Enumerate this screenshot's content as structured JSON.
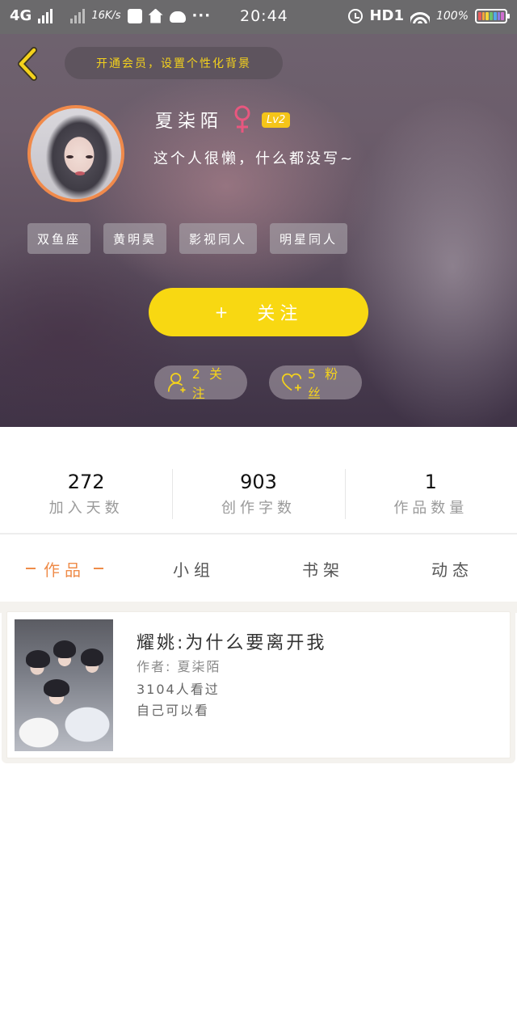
{
  "status_bar": {
    "network": "4G",
    "speed": "16K/s",
    "time": "20:44",
    "hd": "HD1",
    "battery_percent": "100%",
    "icons": [
      "signal-icon",
      "alipay-icon",
      "home-icon",
      "cloud-icon",
      "more-icon",
      "alarm-icon",
      "wifi-icon",
      "battery-icon"
    ]
  },
  "header": {
    "back_icon": "chevron-left-icon",
    "vip_banner": "开通会员，设置个性化背景",
    "username": "夏柒陌",
    "gender_icon": "female-icon",
    "level": "Lv2",
    "signature": "这个人很懒，什么都没写~",
    "tags": [
      "双鱼座",
      "黄明昊",
      "影视同人",
      "明星同人"
    ],
    "follow_button": {
      "plus": "+",
      "label": "关注"
    },
    "following": {
      "icon": "add-user-icon",
      "label": "2 关注"
    },
    "fans": {
      "icon": "heart-plus-icon",
      "label": "5 粉丝"
    }
  },
  "stats": [
    {
      "value": "272",
      "label": "加入天数"
    },
    {
      "value": "903",
      "label": "创作字数"
    },
    {
      "value": "1",
      "label": "作品数量"
    }
  ],
  "tabs": [
    {
      "label": "作品",
      "active": true
    },
    {
      "label": "小组",
      "active": false
    },
    {
      "label": "书架",
      "active": false
    },
    {
      "label": "动态",
      "active": false
    }
  ],
  "works": [
    {
      "title": "耀姚:为什么要离开我",
      "author": "作者: 夏柒陌",
      "views": "3104人看过",
      "privacy": "自己可以看"
    }
  ],
  "colors": {
    "accent_orange": "#ef8c4a",
    "accent_yellow": "#f8d812",
    "vip_text": "#f4d21c",
    "female_pink": "#e8577f"
  }
}
